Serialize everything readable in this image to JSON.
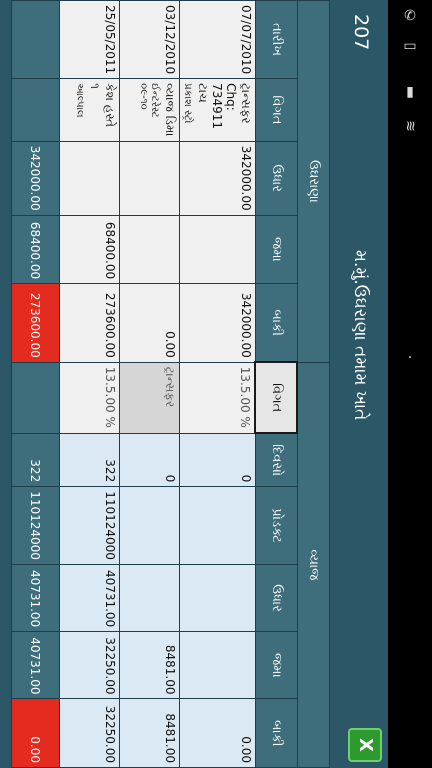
{
  "header": {
    "count": "207",
    "title": "મ.મું.ઉઘરાણા તમામ ખાતે",
    "excel_icon": "excel-export-icon"
  },
  "groups": {
    "left": "ઉઘરાણા",
    "right": "વ્યાજ"
  },
  "columns": [
    "તારીખ",
    "વિગત",
    "ઉધાર",
    "જમા",
    "બાકી",
    "વિગત",
    "દિવસો",
    "પ્રોડક્ટ",
    "ઉધાર",
    "જમા",
    "બાકી"
  ],
  "rows": [
    {
      "date": "07/07/2010",
      "detail": "ટ્રાન્સફર Chq: 734911 ટાચ",
      "detail_sub": "પ્રકાશ સ્ટ્રો",
      "debit": "342000.00",
      "credit": "",
      "balance": "342000.00",
      "int_detail": "13.5.00 %",
      "days": "0",
      "product": "",
      "int_debit": "",
      "int_credit": "",
      "int_balance": "0.00"
    },
    {
      "date": "03/12/2010",
      "detail": "વ્યાજ ડિમા",
      "detail_sub": "ઈન્ટરેસ્ટ ૦૯-૧૦",
      "debit": "",
      "credit": "",
      "balance": "0.00",
      "int_detail": "ટ્રાન્સફર",
      "days": "0",
      "product": "",
      "int_debit": "",
      "int_credit": "8481.00",
      "int_balance": "8481.00"
    },
    {
      "date": "25/05/2011",
      "detail": "કેશ હસ્તે ૧",
      "detail_sub": "આલ્પાલ",
      "debit": "",
      "credit": "68400.00",
      "balance": "273600.00",
      "int_detail": "13.5.00 %",
      "days": "322",
      "product": "110124000",
      "int_debit": "40731.00",
      "int_credit": "32250.00",
      "int_balance": "32250.00"
    }
  ],
  "totals": {
    "debit": "342000.00",
    "credit": "68400.00",
    "balance": "273600.00",
    "days": "322",
    "product": "110124000",
    "int_debit": "40731.00",
    "int_credit": "40731.00",
    "int_balance": "0.00"
  },
  "status_icons": [
    "call-icon",
    "battery-icon",
    "signal-icon",
    "wifi-icon"
  ],
  "colors": {
    "header": "#3e6e7c",
    "negative_total": "#e32b1f",
    "row_blue": "#dbe9f4"
  }
}
